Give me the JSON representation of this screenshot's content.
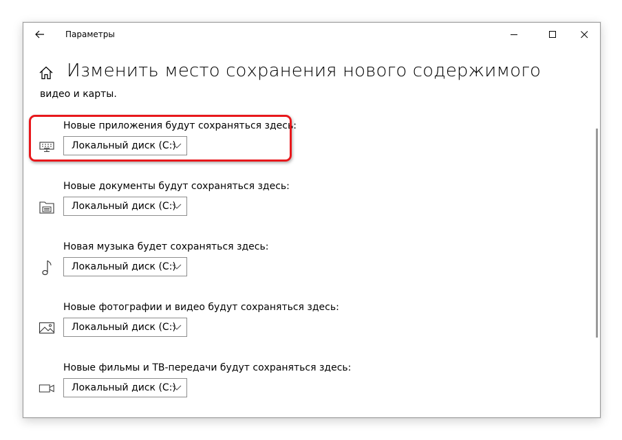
{
  "window": {
    "title": "Параметры"
  },
  "page": {
    "title": "Изменить место сохранения нового содержимого",
    "subtitle": "видео и карты."
  },
  "settings": [
    {
      "label": "Новые приложения будут сохраняться здесь:",
      "value": "Локальный диск (C:)",
      "icon": "apps-keyboard-icon",
      "highlighted": true
    },
    {
      "label": "Новые документы будут сохраняться здесь:",
      "value": "Локальный диск (C:)",
      "icon": "documents-folder-icon",
      "highlighted": false
    },
    {
      "label": "Новая музыка будет сохраняться здесь:",
      "value": "Локальный диск (C:)",
      "icon": "music-note-icon",
      "highlighted": false
    },
    {
      "label": "Новые фотографии и видео будут сохраняться здесь:",
      "value": "Локальный диск (C:)",
      "icon": "picture-icon",
      "highlighted": false
    },
    {
      "label": "Новые фильмы и ТВ-передачи будут сохраняться здесь:",
      "value": "Локальный диск (C:)",
      "icon": "video-camera-icon",
      "highlighted": false
    }
  ],
  "colors": {
    "highlight": "#e8171b",
    "border": "#8c8c8c"
  }
}
